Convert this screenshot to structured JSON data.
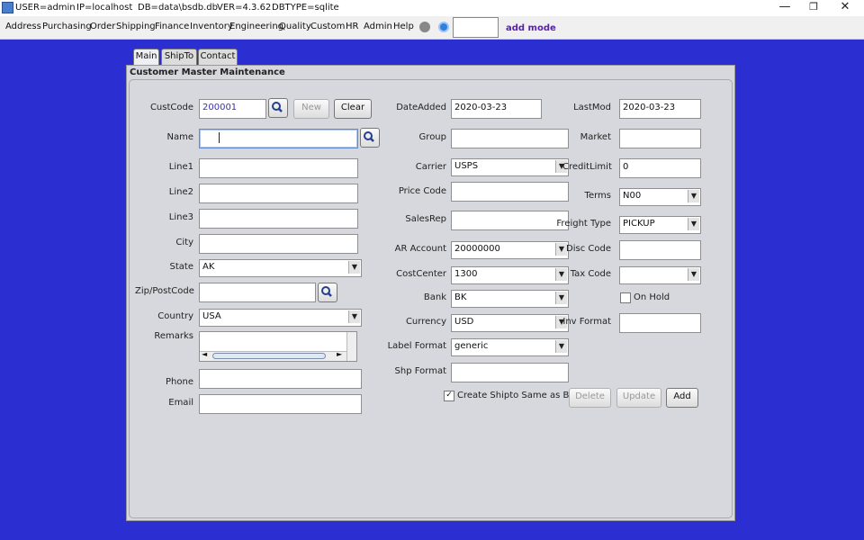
{
  "titlebar": {
    "user": "USER=admin",
    "ip": "IP=localhost",
    "db": "DB=data\\bsdb.db",
    "ver": "VER=4.3.62",
    "dbtype": "DBTYPE=sqlite",
    "minimize": "—",
    "restore": "❐",
    "close": "✕"
  },
  "menu": [
    "Address",
    "Purchasing",
    "Order",
    "Shipping",
    "Finance",
    "Inventory",
    "Engineering",
    "Quality",
    "Custom",
    "HR",
    "Admin",
    "Help"
  ],
  "mode": "add mode",
  "tabs": [
    "Main",
    "ShipTo",
    "Contact"
  ],
  "panel_title": "Customer Master Maintenance",
  "left": {
    "custcode_label": "CustCode",
    "custcode": "200001",
    "new_label": "New",
    "clear_label": "Clear",
    "name_label": "Name",
    "name": "",
    "line1_label": "Line1",
    "line2_label": "Line2",
    "line3_label": "Line3",
    "city_label": "City",
    "state_label": "State",
    "state": "AK",
    "zip_label": "Zip/PostCode",
    "country_label": "Country",
    "country": "USA",
    "remarks_label": "Remarks",
    "phone_label": "Phone",
    "email_label": "Email"
  },
  "middle": {
    "dateadded_label": "DateAdded",
    "dateadded": "2020-03-23",
    "group_label": "Group",
    "carrier_label": "Carrier",
    "carrier": "USPS",
    "pricecode_label": "Price Code",
    "salesrep_label": "SalesRep",
    "araccount_label": "AR Account",
    "araccount": "20000000",
    "costcenter_label": "CostCenter",
    "costcenter": "1300",
    "bank_label": "Bank",
    "bank": "BK",
    "currency_label": "Currency",
    "currency": "USD",
    "labelformat_label": "Label Format",
    "labelformat": "generic",
    "shpformat_label": "Shp Format",
    "create_shipto_label": "Create Shipto Same as Billto",
    "delete_label": "Delete",
    "update_label": "Update",
    "add_label": "Add"
  },
  "right": {
    "lastmod_label": "LastMod",
    "lastmod": "2020-03-23",
    "market_label": "Market",
    "creditlimit_label": "CreditLimit",
    "creditlimit": "0",
    "terms_label": "Terms",
    "terms": "N00",
    "freighttype_label": "Freight Type",
    "freighttype": "PICKUP",
    "disccode_label": "Disc Code",
    "taxcode_label": "Tax Code",
    "taxcode": "",
    "onhold_label": "On Hold",
    "invformat_label": "Inv Format"
  },
  "checkbox_states": {
    "create_shipto": true,
    "on_hold": false
  },
  "colors": {
    "background": "#2b2fd2",
    "panel": "#d7d8dd",
    "mode_text": "#5a1fb0",
    "custcode_text": "#3a2fb8"
  }
}
